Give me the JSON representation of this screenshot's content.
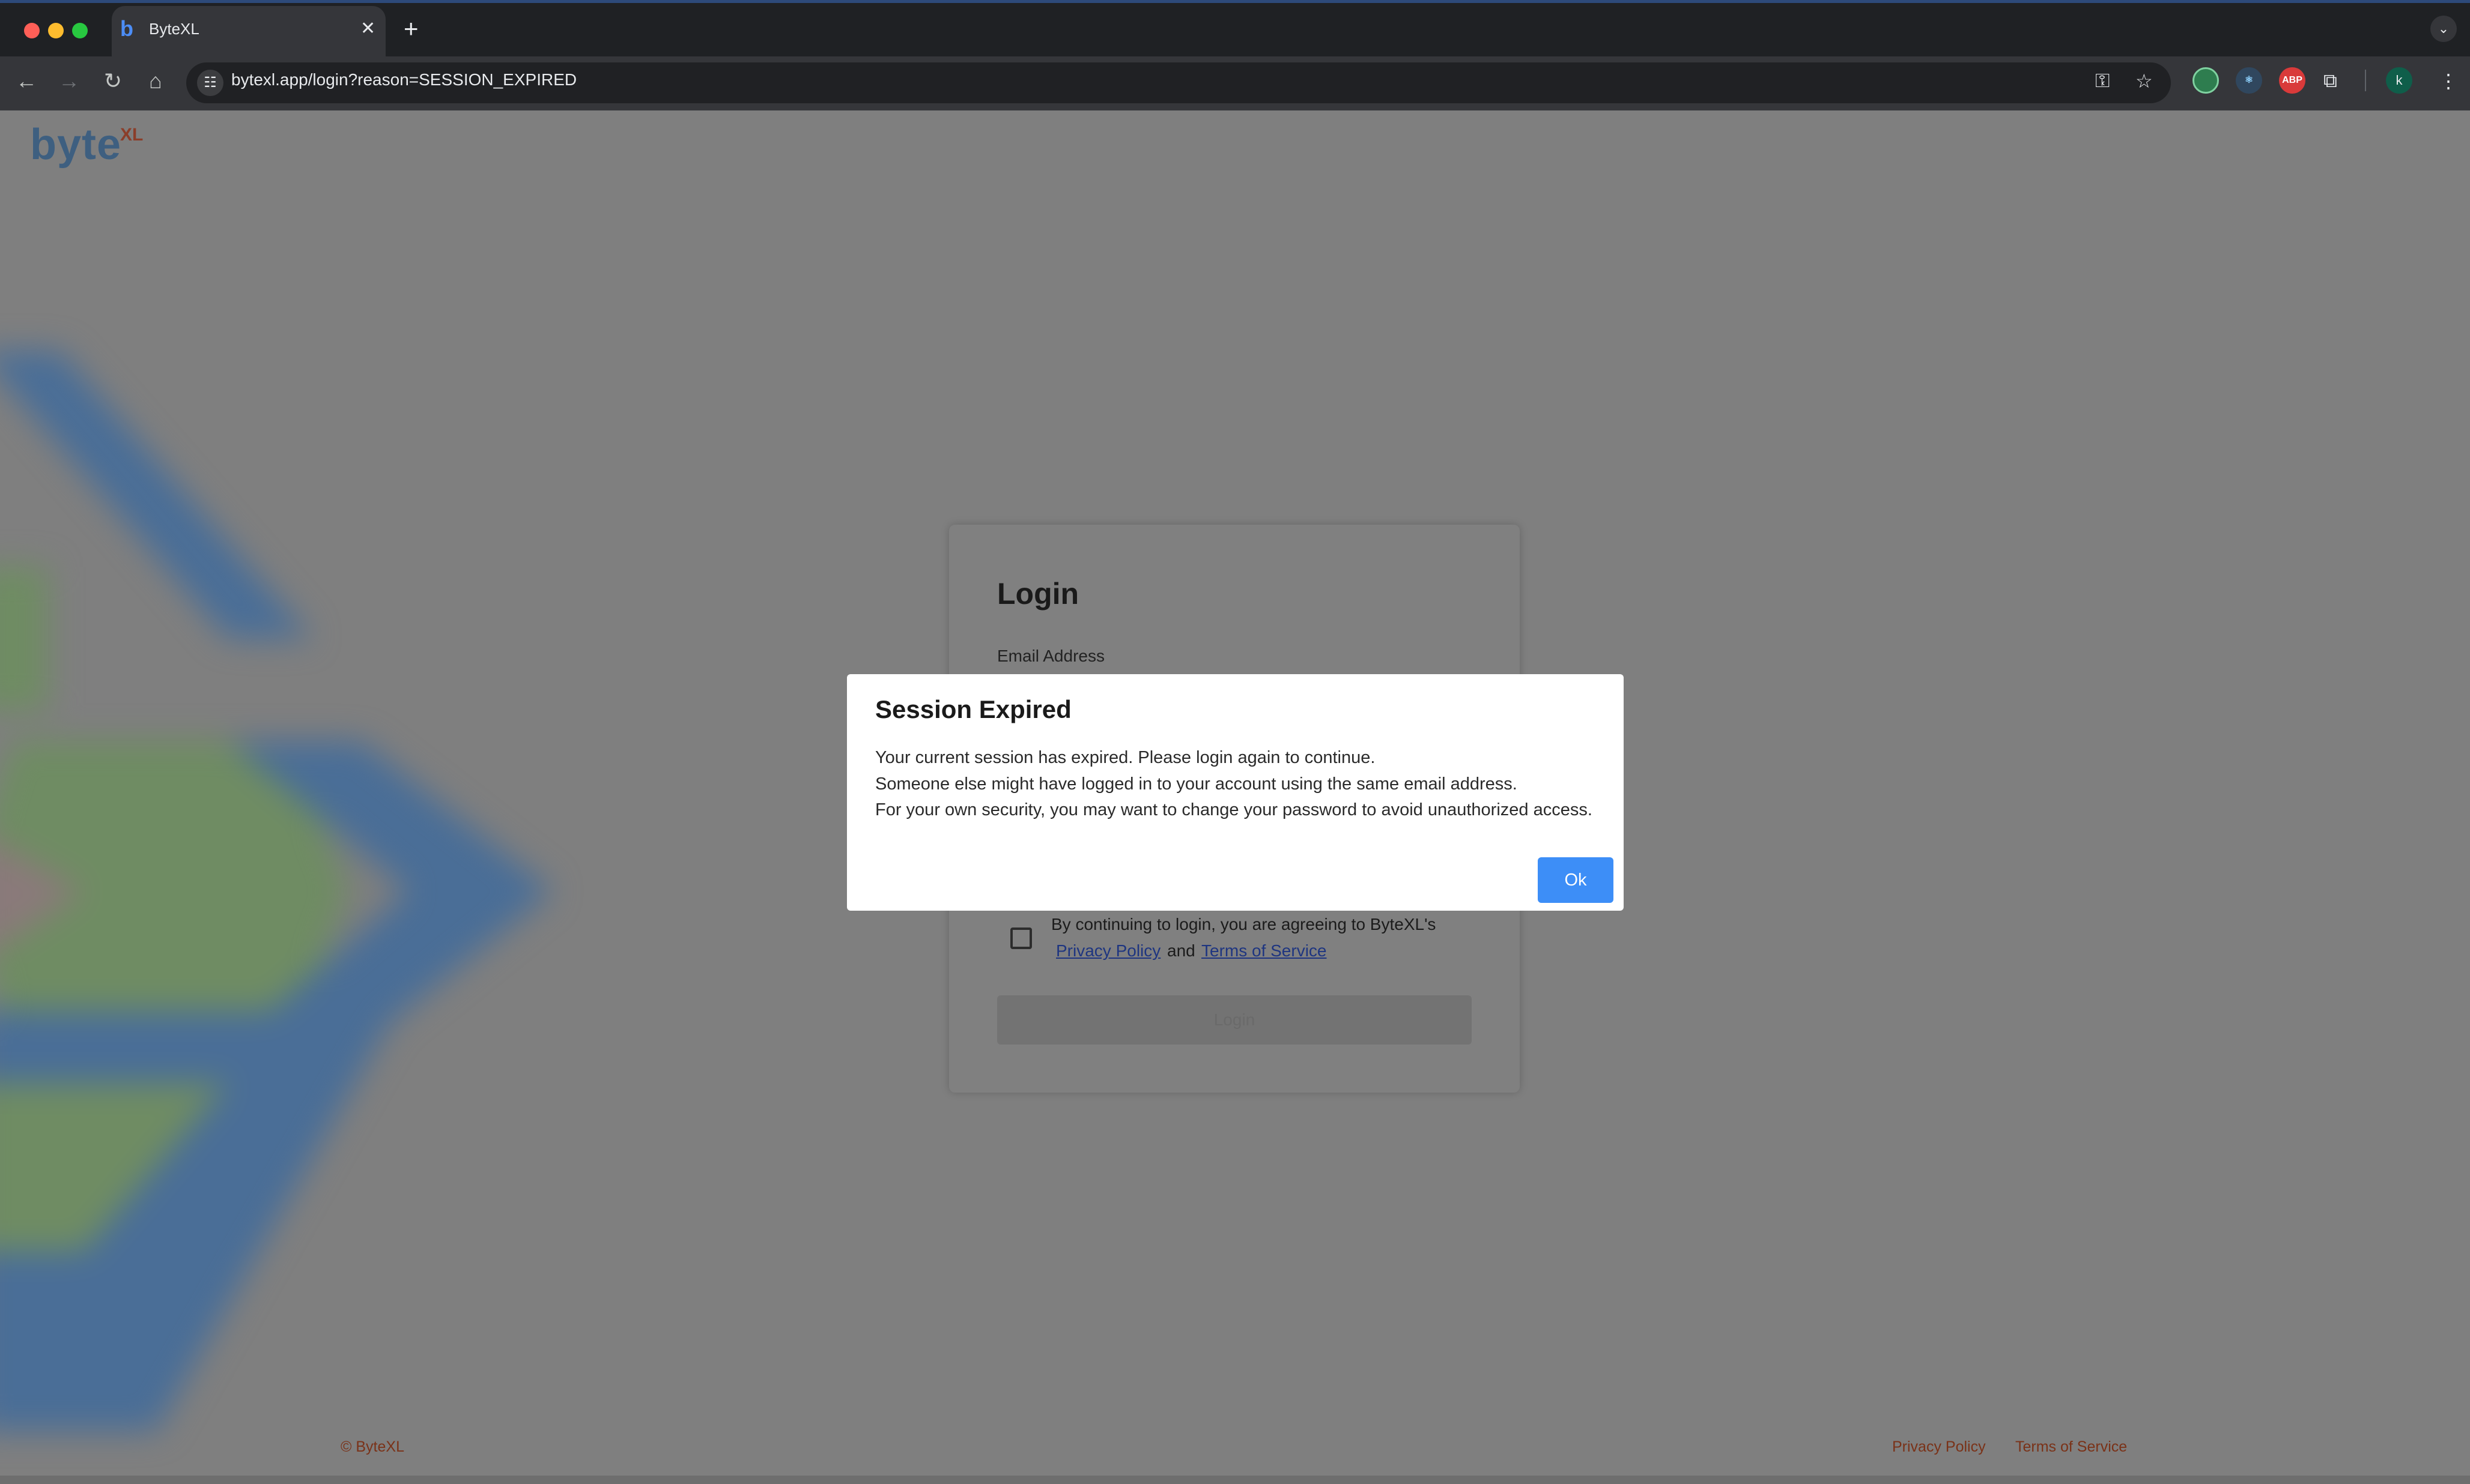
{
  "browser": {
    "tab_title": "ByteXL",
    "tab_favicon": "b",
    "url": "bytexl.app/login?reason=SESSION_EXPIRED",
    "profile_initial": "k",
    "extension_abp_label": "ABP",
    "icons": {
      "back": "←",
      "forward": "→",
      "reload": "↻",
      "home": "⌂",
      "site_info": "☷",
      "password_key": "⚿",
      "bookmark": "☆",
      "extensions": "⧉",
      "menu": "⋮",
      "close_tab": "✕",
      "new_tab": "+",
      "tab_list": "⌄"
    },
    "traffic_colors": [
      "#ff5f57",
      "#febc2e",
      "#28c840"
    ]
  },
  "brand": {
    "logo_text": "byte",
    "logo_superscript": "XL"
  },
  "login_form": {
    "title": "Login",
    "email_label": "Email Address",
    "agreement_text": "By continuing to login, you are agreeing to ByteXL's",
    "privacy_link": "Privacy Policy",
    "and_text": "and",
    "terms_link": "Terms of Service",
    "login_button": "Login"
  },
  "footer": {
    "copyright": "© ByteXL",
    "privacy": "Privacy Policy",
    "terms": "Terms of Service"
  },
  "modal": {
    "title": "Session Expired",
    "lines": [
      "Your current session has expired. Please login again to continue.",
      "Someone else might have logged in to your account using the same email address.",
      "For your own security, you may want to change your password to avoid unauthorized access."
    ],
    "ok_button": "Ok"
  },
  "colors": {
    "accent": "#3d8ef7",
    "overlay": "#7f7f7f",
    "footer_text": "#7a3218"
  }
}
